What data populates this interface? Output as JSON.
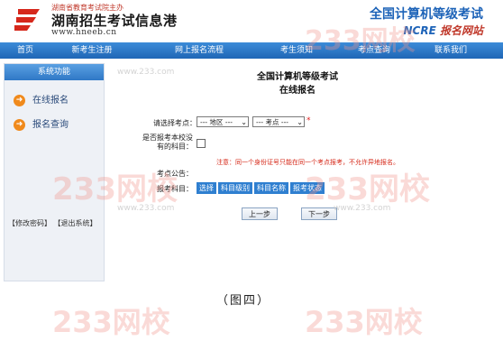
{
  "header": {
    "logo_small": "湖南省教育考试院主办",
    "logo_title": "湖南招生考试信息港",
    "logo_url": "www.hneeb.cn",
    "ncre_title": "全国计算机等级考试",
    "ncre_sub_prefix": "NCRE",
    "ncre_sub_suffix": "报名网站"
  },
  "nav": {
    "items": [
      "首页",
      "新考生注册",
      "网上报名流程",
      "考生须知",
      "考点查询",
      "联系我们"
    ]
  },
  "sidebar": {
    "title": "系统功能",
    "items": [
      "在线报名",
      "报名查询"
    ],
    "link_change_password": "【修改密码】",
    "link_logout": "【退出系统】"
  },
  "form": {
    "title_line1": "全国计算机等级考试",
    "title_line2": "在线报名",
    "site_label": "请选择考点：",
    "region_select": "--- 地区 ---",
    "site_select": "--- 考点 ---",
    "required_mark": "*",
    "local_exam_label_line1": "是否报考本校没",
    "local_exam_label_line2": "有的科目：",
    "notice": "注意：同一个身份证号只能在同一个考点报考，不允许异地报名。",
    "announcement_label": "考点公告：",
    "subjects_label": "报考科目：",
    "subject_buttons": [
      "选择",
      "科目级别",
      "科目名称",
      "报考状态"
    ],
    "prev_button": "上一步",
    "next_button": "下一步"
  },
  "caption": "（图四）",
  "watermark": {
    "text": "233网校",
    "small": "www.233.com"
  },
  "colors": {
    "nav_blue": "#1f66b6",
    "accent_orange": "#f08a1c",
    "warning_red": "#d62a1a"
  }
}
